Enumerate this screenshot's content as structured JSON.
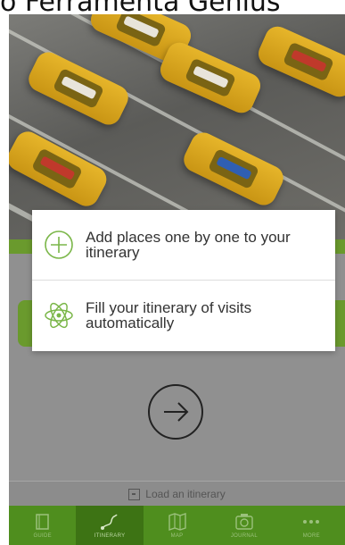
{
  "caption": "o  Ferramenta Genius",
  "menu": {
    "add_places_label": "Add places one by one to your itinerary",
    "fill_itinerary_label": "Fill your itinerary of visits automatically"
  },
  "load": {
    "label": "Load an itinerary"
  },
  "tabs": [
    {
      "label": "GUIDE"
    },
    {
      "label": "ITINERARY"
    },
    {
      "label": "MAP"
    },
    {
      "label": "JOURNAL"
    },
    {
      "label": "MORE"
    }
  ],
  "colors": {
    "brand_green": "#4f8e1e",
    "icon_green": "#7ab648",
    "overlay_gray": "#909090"
  },
  "icons": {
    "add_places": "plus-circle-icon",
    "fill_itinerary": "atom-icon",
    "next": "arrow-right-circle-icon",
    "load": "load-itinerary-icon"
  }
}
